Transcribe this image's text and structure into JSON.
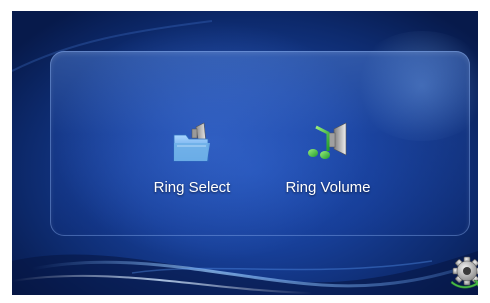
{
  "menu": {
    "items": [
      {
        "label": "Ring Select",
        "icon": "ring-select-folder-icon"
      },
      {
        "label": "Ring Volume",
        "icon": "ring-volume-speaker-icon"
      }
    ]
  },
  "settings": {
    "icon": "settings-gear-icon"
  },
  "colors": {
    "background": "#173f98",
    "label": "#ffffff",
    "folder": "#6fb0e8",
    "music_note": "#3fbf4a",
    "speaker": "#c9c9c9",
    "gear_accent": "#48b848"
  }
}
